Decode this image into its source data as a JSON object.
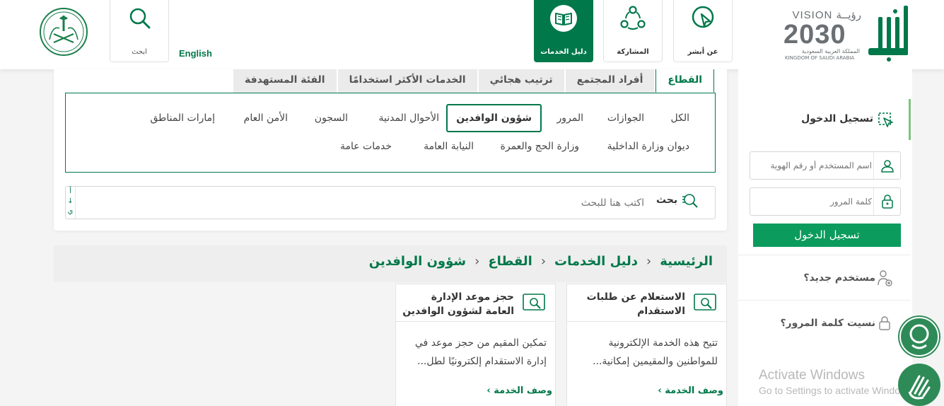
{
  "header": {
    "logo_absher_text": "أبشر",
    "vision": {
      "line1": "VISION رؤيــة",
      "line2": "2030",
      "line3": "المملكة العربية السعودية",
      "line4": "KINGDOM OF SAUDI ARABIA"
    },
    "nav": [
      {
        "label": "عن أبشر"
      },
      {
        "label": "المشاركة"
      },
      {
        "label": "دليل الخدمات"
      }
    ],
    "english_label": "English",
    "search_label": "ابحث"
  },
  "tabs": [
    "القطاع",
    "أفراد المجتمع",
    "ترتيب هجائي",
    "الخدمات الأكثر استخدامًا",
    "الفئة المستهدفة"
  ],
  "active_tab": "القطاع",
  "categories_row1": [
    "الكل",
    "الجوازات",
    "المرور",
    "شؤون الوافدين",
    "الأحوال المدنية",
    "السجون",
    "الأمن العام",
    "إمارات المناطق"
  ],
  "categories_row2": [
    "ديوان وزارة الداخلية",
    "وزارة الحج والعمرة",
    "النيابة العامة",
    "خدمات عامة"
  ],
  "selected_category": "شؤون الوافدين",
  "search": {
    "button": "بحث",
    "placeholder": "اكتب هنا للبحث",
    "alpha_toggle": "أ ↓ ي"
  },
  "breadcrumb": [
    "الرئيسية",
    "دليل الخدمات",
    "القطاع",
    "شؤون الوافدين"
  ],
  "breadcrumb_sep": "›",
  "cards": [
    {
      "title": "الاستعلام عن طلبات الاستقدام",
      "description": "تتيح هذه الخدمة الإلكترونية للمواطنين والمقيمين إمكانية...",
      "more": "وصف الخدمة ›"
    },
    {
      "title": "حجز موعد الإدارة العامة لشؤون الوافدين",
      "description": "تمكين المقيم من حجز موعد في إدارة الاستقدام إلكترونيًا لطل...",
      "more": "وصف الخدمة ›"
    }
  ],
  "sidebar": {
    "login_title": "تسجيل الدخول",
    "username_placeholder": "اسم المستخدم أو رقم الهوية",
    "password_placeholder": "كلمة المرور",
    "login_button": "تسجيل الدخول",
    "new_user": "مستخدم جديد؟",
    "forgot_password": "نسيت كلمة المرور؟"
  },
  "watermark": {
    "line1": "Activate Windows",
    "line2": "Go to Settings to activate Windows."
  },
  "colors": {
    "primary": "#00784a",
    "button": "#0b9b5c",
    "accent_bar": "#7cc47e"
  }
}
